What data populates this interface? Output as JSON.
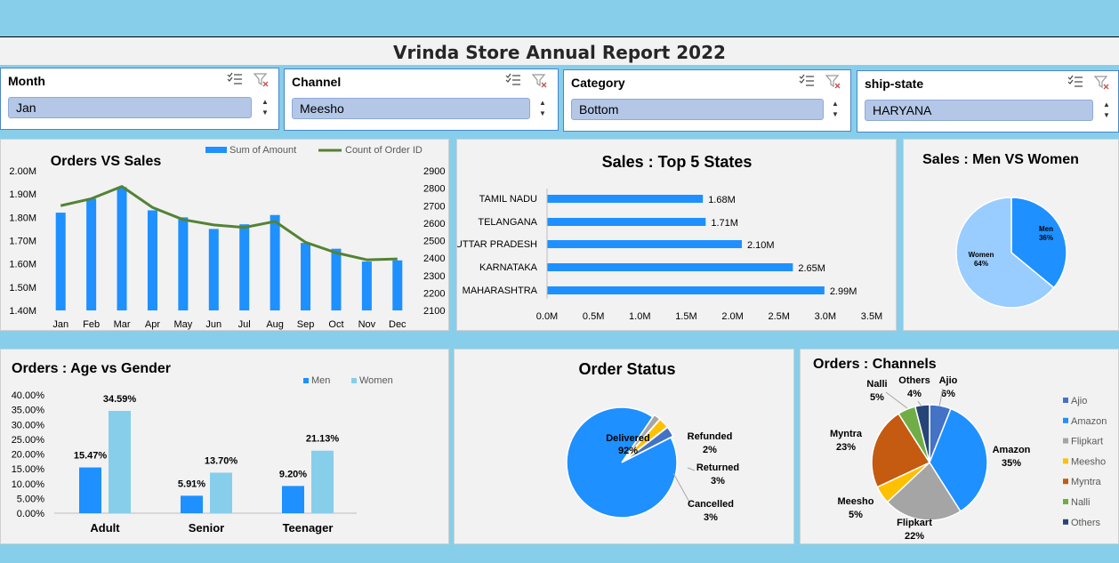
{
  "report_title": "Vrinda Store Annual Report 2022",
  "slicers": [
    {
      "header": "Month",
      "selected": "Jan"
    },
    {
      "header": "Channel",
      "selected": "Meesho"
    },
    {
      "header": "Category",
      "selected": "Bottom"
    },
    {
      "header": "ship-state",
      "selected": "HARYANA"
    }
  ],
  "icons": {
    "multiselect": "multi-select-icon",
    "clear_filter": "clear-filter-icon",
    "scroll": "scroll-arrows-icon"
  },
  "colors": {
    "background": "#87CEEB",
    "panel": "#F2F2F2",
    "bar_blue": "#1E90FF",
    "light_blue": "#87CEEB",
    "line_green": "#548235",
    "slicer_item": "#B4C7E7"
  },
  "chart_data": [
    {
      "type": "bar",
      "title": "Orders VS Sales",
      "categories": [
        "Jan",
        "Feb",
        "Mar",
        "Apr",
        "May",
        "Jun",
        "Jul",
        "Aug",
        "Sep",
        "Oct",
        "Nov",
        "Dec"
      ],
      "series": [
        {
          "name": "Sum of Amount",
          "type": "bar",
          "axis": "left",
          "values": [
            1.82,
            1.88,
            1.93,
            1.83,
            1.8,
            1.75,
            1.77,
            1.81,
            1.69,
            1.665,
            1.61,
            1.615
          ]
        },
        {
          "name": "Count of Order ID",
          "type": "line",
          "axis": "right",
          "values": [
            2700,
            2740,
            2810,
            2690,
            2620,
            2590,
            2575,
            2610,
            2490,
            2430,
            2390,
            2395
          ]
        }
      ],
      "left_ticks": [
        "2.00M",
        "1.90M",
        "1.80M",
        "1.70M",
        "1.60M",
        "1.50M",
        "1.40M"
      ],
      "left_range": [
        1.4,
        2.0
      ],
      "right_ticks": [
        "2900",
        "2800",
        "2700",
        "2600",
        "2500",
        "2400",
        "2300",
        "2200",
        "2100"
      ],
      "right_range": [
        2100,
        2900
      ],
      "legend": "top",
      "grid": false
    },
    {
      "type": "bar",
      "orientation": "horizontal",
      "title": "Sales : Top 5 States",
      "categories": [
        "TAMIL NADU",
        "TELANGANA",
        "UTTAR PRADESH",
        "KARNATAKA",
        "MAHARASHTRA"
      ],
      "values": [
        1.68,
        1.71,
        2.1,
        2.65,
        2.99
      ],
      "labels": [
        "1.68M",
        "1.71M",
        "2.10M",
        "2.65M",
        "2.99M"
      ],
      "x_ticks": [
        "0.0M",
        "0.5M",
        "1.0M",
        "1.5M",
        "2.0M",
        "2.5M",
        "3.0M",
        "3.5M"
      ],
      "xlim": [
        0,
        3.5
      ],
      "grid": false
    },
    {
      "type": "pie",
      "title": "Sales : Men VS Women",
      "slices": [
        {
          "label": "Men",
          "value": 36,
          "pct": "36%"
        },
        {
          "label": "Women",
          "value": 64,
          "pct": "64%"
        }
      ]
    },
    {
      "type": "bar",
      "title": "Orders : Age vs Gender",
      "categories": [
        "Adult",
        "Senior",
        "Teenager"
      ],
      "series": [
        {
          "name": "Men",
          "values": [
            15.47,
            5.91,
            9.2
          ],
          "labels": [
            "15.47%",
            "5.91%",
            "9.20%"
          ]
        },
        {
          "name": "Women",
          "values": [
            34.59,
            13.7,
            21.13
          ],
          "labels": [
            "34.59%",
            "13.70%",
            "21.13%"
          ]
        }
      ],
      "y_ticks": [
        "40.00%",
        "35.00%",
        "30.00%",
        "25.00%",
        "20.00%",
        "15.00%",
        "10.00%",
        "5.00%",
        "0.00%"
      ],
      "ylim": [
        0,
        40
      ],
      "legend": "top-right",
      "grid": false
    },
    {
      "type": "pie",
      "title": "Order Status",
      "slices": [
        {
          "label": "Delivered",
          "value": 92,
          "pct": "92%"
        },
        {
          "label": "Refunded",
          "value": 2,
          "pct": "2%"
        },
        {
          "label": "Returned",
          "value": 3,
          "pct": "3%"
        },
        {
          "label": "Cancelled",
          "value": 3,
          "pct": "3%"
        }
      ]
    },
    {
      "type": "pie",
      "title": "Orders : Channels",
      "slices": [
        {
          "label": "Ajio",
          "value": 6,
          "pct": "6%"
        },
        {
          "label": "Amazon",
          "value": 35,
          "pct": "35%"
        },
        {
          "label": "Flipkart",
          "value": 22,
          "pct": "22%"
        },
        {
          "label": "Meesho",
          "value": 5,
          "pct": "5%"
        },
        {
          "label": "Myntra",
          "value": 23,
          "pct": "23%"
        },
        {
          "label": "Nalli",
          "value": 5,
          "pct": "5%"
        },
        {
          "label": "Others",
          "value": 4,
          "pct": "4%"
        }
      ],
      "legend": "right"
    }
  ]
}
